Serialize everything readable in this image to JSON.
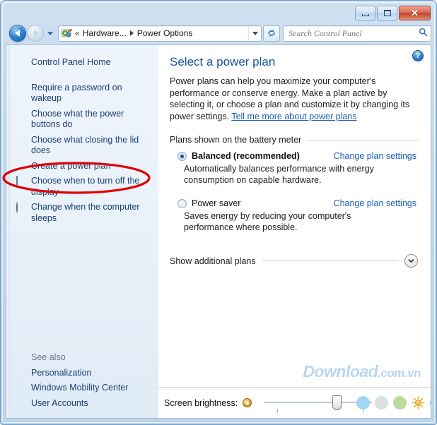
{
  "window": {
    "caption_buttons": {
      "minimize_label": "Minimize",
      "maximize_label": "Maximize",
      "close_label": "✕"
    }
  },
  "navbar": {
    "back_label": "Back",
    "forward_label": "Forward",
    "recent_pages_label": "Recent pages",
    "breadcrumb": {
      "overflow": "«",
      "items": [
        "Hardware...",
        "Power Options"
      ],
      "dropdown_label": "Previous locations"
    },
    "refresh_label": "↻",
    "search": {
      "placeholder": "Search Control Panel",
      "value": "",
      "icon": "search-icon"
    }
  },
  "sidebar": {
    "home_label": "Control Panel Home",
    "items": [
      {
        "label": "Require a password on wakeup",
        "icon": null
      },
      {
        "label": "Choose what the power buttons do",
        "icon": null
      },
      {
        "label": "Choose what closing the lid does",
        "icon": null
      },
      {
        "label": "Create a power plan",
        "icon": null
      },
      {
        "label": "Choose when to turn off the display",
        "icon": "monitor-icon"
      },
      {
        "label": "Change when the computer sleeps",
        "icon": "sleep-moon-icon"
      }
    ],
    "see_also": {
      "title": "See also",
      "items": [
        "Personalization",
        "Windows Mobility Center",
        "User Accounts"
      ]
    }
  },
  "content": {
    "help_label": "?",
    "title": "Select a power plan",
    "intro_part1": "Power plans can help you maximize your computer's performance or conserve energy. Make a plan active by selecting it, or choose a plan and customize it by changing its power settings. ",
    "intro_link": "Tell me more about power plans",
    "section_label": "Plans shown on the battery meter",
    "plans": [
      {
        "name": "Balanced (recommended)",
        "description": "Automatically balances performance with energy consumption on capable hardware.",
        "link": "Change plan settings",
        "selected": true
      },
      {
        "name": "Power saver",
        "description": "Saves energy by reducing your computer's performance where possible.",
        "link": "Change plan settings",
        "selected": false
      }
    ],
    "additional_label": "Show additional plans",
    "expander_icon": "chevron-down-icon"
  },
  "brightness": {
    "label": "Screen brightness:",
    "bulb_icon": "brightness-bulb-icon",
    "slider_value_percent": 63,
    "sun_icon": "sun-icon",
    "bubble_colors": [
      "#9ed7ef",
      "#dcdfe0",
      "#b9dd9a",
      "#8cc5e8",
      "#f3adb0"
    ]
  },
  "watermark": {
    "brand": "Download",
    "suffix": ".com.vn"
  },
  "annotation": {
    "type": "red-ellipse-highlight",
    "color": "#e00000",
    "targets_label": "Choose when to turn off the display"
  },
  "colors": {
    "title_blue": "#15539e",
    "link_blue": "#1a5fb4",
    "sidebar_link": "#1c3f73",
    "accent": "#e00000"
  }
}
